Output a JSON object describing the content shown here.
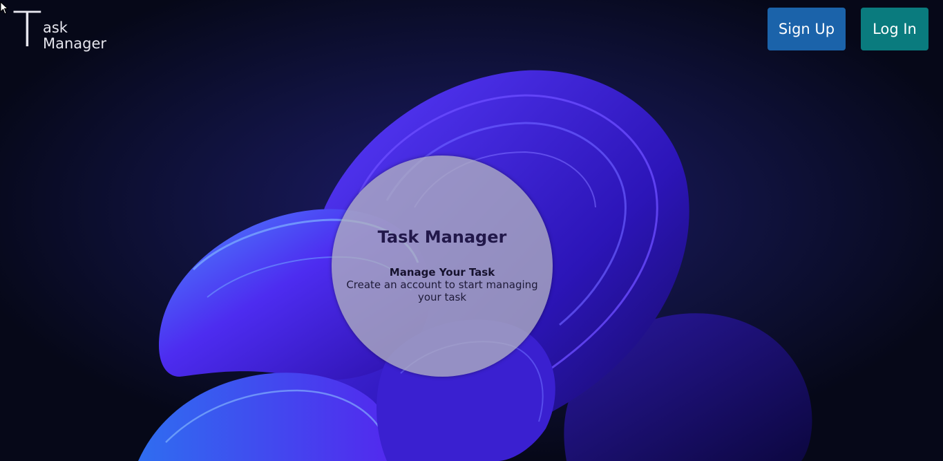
{
  "logo": {
    "letter": "T",
    "line1": "ask",
    "line2": "Manager"
  },
  "nav": {
    "signup_label": "Sign Up",
    "login_label": "Log In"
  },
  "hero": {
    "title": "Task Manager",
    "subtitle": "Manage Your Task",
    "text": "Create an account to start managing your task"
  },
  "colors": {
    "background": "#070a1e",
    "signup_button": "#1b63aa",
    "login_button": "#0a7b7e",
    "wallpaper_primary": "#3b1fe0",
    "wallpaper_highlight": "#3f8df5"
  },
  "icons": {
    "cursor": "mouse-pointer-icon"
  }
}
